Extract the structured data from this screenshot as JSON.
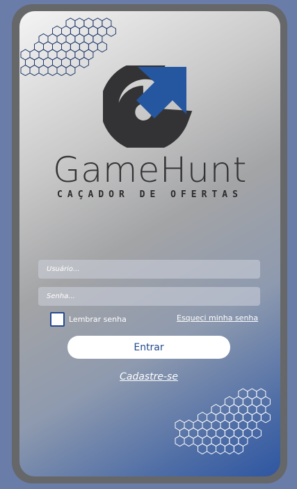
{
  "brand": {
    "name": "GameHunt",
    "tagline": "CAÇADOR DE OFERTAS"
  },
  "form": {
    "username_placeholder": "Usuário...",
    "username_value": "",
    "password_placeholder": "Senha...",
    "password_value": "",
    "remember_label": "Lembrar senha",
    "remember_checked": false,
    "forgot_label": "Esqueci minha senha",
    "submit_label": "Entrar",
    "register_label": "Cadastre-se"
  },
  "colors": {
    "background": "#6a7ca8",
    "frame": "#666769",
    "logo_dark": "#333335",
    "logo_blue": "#2556a0",
    "button_text": "#234a8c"
  },
  "icons": {
    "logo": "gamehunt-logo-icon",
    "decor_top": "hexagon-pattern-icon",
    "decor_bottom": "hexagon-pattern-icon"
  }
}
